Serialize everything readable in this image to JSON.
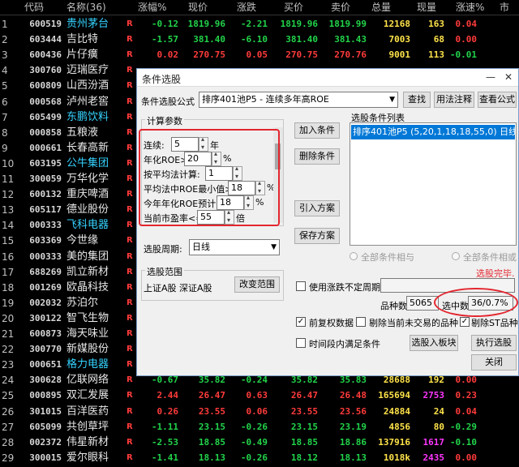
{
  "header": {
    "cols": [
      "代码",
      "名称(36)",
      "涨幅%",
      "现价",
      "涨跌",
      "买价",
      "卖价",
      "总量",
      "现量",
      "涨速%",
      "市"
    ]
  },
  "rows": [
    {
      "i": "1",
      "code": "600519",
      "name": "贵州茅台",
      "cy": true,
      "pct": "-0.12",
      "price": "1819.96",
      "chg": "-2.21",
      "bid": "1819.96",
      "ask": "1819.99",
      "vol": "12168",
      "cur": "163",
      "spd": "0.04",
      "dir": "dn"
    },
    {
      "i": "2",
      "code": "603444",
      "name": "吉比特",
      "cy": false,
      "pct": "-1.57",
      "price": "381.40",
      "chg": "-6.10",
      "bid": "381.40",
      "ask": "381.43",
      "vol": "7003",
      "cur": "68",
      "spd": "0.00",
      "dir": "dn"
    },
    {
      "i": "3",
      "code": "600436",
      "name": "片仔癀",
      "cy": false,
      "pct": "0.02",
      "price": "270.75",
      "chg": "0.05",
      "bid": "270.75",
      "ask": "270.76",
      "vol": "9001",
      "cur": "113",
      "spd": "-0.01",
      "dir": "up"
    },
    {
      "i": "4",
      "code": "300760",
      "name": "迈瑞医疗",
      "cy": false,
      "pct": "",
      "price": "",
      "chg": "",
      "bid": "",
      "ask": "",
      "vol": "",
      "cur": "",
      "spd": "",
      "dir": "dn"
    },
    {
      "i": "5",
      "code": "600809",
      "name": "山西汾酒",
      "cy": false
    },
    {
      "i": "6",
      "code": "000568",
      "name": "泸州老窖",
      "cy": false
    },
    {
      "i": "7",
      "code": "605499",
      "name": "东鹏饮料",
      "cy": true
    },
    {
      "i": "8",
      "code": "000858",
      "name": "五粮液",
      "cy": false
    },
    {
      "i": "9",
      "code": "000661",
      "name": "长春高新",
      "cy": false
    },
    {
      "i": "10",
      "code": "603195",
      "name": "公牛集团",
      "cy": true
    },
    {
      "i": "11",
      "code": "300059",
      "name": "万华化学",
      "cy": false
    },
    {
      "i": "12",
      "code": "600132",
      "name": "重庆啤酒",
      "cy": false
    },
    {
      "i": "13",
      "code": "605117",
      "name": "德业股份",
      "cy": false
    },
    {
      "i": "14",
      "code": "000333",
      "name": "飞科电器",
      "cy": true
    },
    {
      "i": "15",
      "code": "603369",
      "name": "今世缘",
      "cy": false
    },
    {
      "i": "16",
      "code": "000333",
      "name": "美的集团",
      "cy": false
    },
    {
      "i": "17",
      "code": "688269",
      "name": "凯立新材",
      "cy": false
    },
    {
      "i": "18",
      "code": "001269",
      "name": "欧晶科技",
      "cy": false
    },
    {
      "i": "19",
      "code": "002032",
      "name": "苏泊尔",
      "cy": false
    },
    {
      "i": "20",
      "code": "300122",
      "name": "智飞生物",
      "cy": false
    },
    {
      "i": "21",
      "code": "600873",
      "name": "海天味业",
      "cy": false
    },
    {
      "i": "22",
      "code": "300770",
      "name": "新媒股份",
      "cy": false
    },
    {
      "i": "23",
      "code": "000651",
      "name": "格力电器",
      "cy": true
    },
    {
      "i": "24",
      "code": "300628",
      "name": "亿联网络",
      "cy": false,
      "pct": "-0.67",
      "price": "35.82",
      "chg": "-0.24",
      "bid": "35.82",
      "ask": "35.83",
      "vol": "28688",
      "cur": "192",
      "spd": "0.00",
      "dir": "dn"
    },
    {
      "i": "25",
      "code": "000895",
      "name": "双汇发展",
      "cy": false,
      "pct": "2.44",
      "price": "26.47",
      "chg": "0.63",
      "bid": "26.47",
      "ask": "26.48",
      "vol": "165694",
      "cur": "2753",
      "spd": "0.23",
      "dir": "up"
    },
    {
      "i": "26",
      "code": "301015",
      "name": "百洋医药",
      "cy": false,
      "pct": "0.26",
      "price": "23.55",
      "chg": "0.06",
      "bid": "23.55",
      "ask": "23.56",
      "vol": "24884",
      "cur": "24",
      "spd": "0.04",
      "dir": "up"
    },
    {
      "i": "27",
      "code": "605099",
      "name": "共创草坪",
      "cy": false,
      "pct": "-1.11",
      "price": "23.15",
      "chg": "-0.26",
      "bid": "23.15",
      "ask": "23.19",
      "vol": "4856",
      "cur": "80",
      "spd": "-0.29",
      "dir": "dn"
    },
    {
      "i": "28",
      "code": "002372",
      "name": "伟星新材",
      "cy": false,
      "pct": "-2.53",
      "price": "18.85",
      "chg": "-0.49",
      "bid": "18.85",
      "ask": "18.86",
      "vol": "137916",
      "cur": "1617",
      "spd": "-0.10",
      "dir": "dn"
    },
    {
      "i": "29",
      "code": "300015",
      "name": "爱尔眼科",
      "cy": false,
      "pct": "-1.41",
      "price": "18.13",
      "chg": "-0.26",
      "bid": "18.12",
      "ask": "18.13",
      "vol": "1018k",
      "cur": "2435",
      "spd": "0.00",
      "dir": "dn"
    }
  ],
  "dialog": {
    "title": "条件选股",
    "formula_label": "条件选股公式",
    "formula_value": "排序401池P5  - 连续多年高ROE",
    "find": "查找",
    "help": "用法注释",
    "view": "查看公式",
    "calc_params": "计算参数",
    "params": [
      {
        "label": "连续:",
        "value": "5",
        "unit": "年"
      },
      {
        "label": "年化ROE>=",
        "value": "20",
        "unit": "%"
      },
      {
        "label": "按平均法计算:",
        "value": "1",
        "unit": ""
      },
      {
        "label": "平均法中ROE最小值>=",
        "value": "18",
        "unit": "%"
      },
      {
        "label": "今年年化ROE预计>=",
        "value": "18",
        "unit": "%"
      },
      {
        "label": "当前市盈率<=",
        "value": "55",
        "unit": "倍"
      }
    ],
    "add_cond": "加入条件",
    "del_cond": "删除条件",
    "import": "引入方案",
    "save": "保存方案",
    "list_title": "选股条件列表",
    "list_item": "排序401池P5 (5,20,1,18,18,55,0) 日线",
    "period_label": "选股周期:",
    "period_value": "日线",
    "all_and": "全部条件相与",
    "all_or": "全部条件相或",
    "done": "选股完毕.",
    "range_title": "选股范围",
    "range_value": "上证A股 深证A股",
    "change_range": "改变范围",
    "use_ext": "使用涨跌不定周期",
    "count_label": "品种数",
    "count_value": "5065",
    "hit_label": "选中数",
    "hit_value": "36/0.7%",
    "adj": "前复权数据",
    "skip_halt": "剔除当前未交易的品种",
    "skip_st": "剔除ST品种",
    "time_cond": "时间段内满足条件",
    "to_block": "选股入板块",
    "exec": "执行选股",
    "close": "关闭"
  },
  "colors": {
    "up": "#ff3b3b",
    "down": "#22d34a",
    "hl": "#e3262f"
  }
}
